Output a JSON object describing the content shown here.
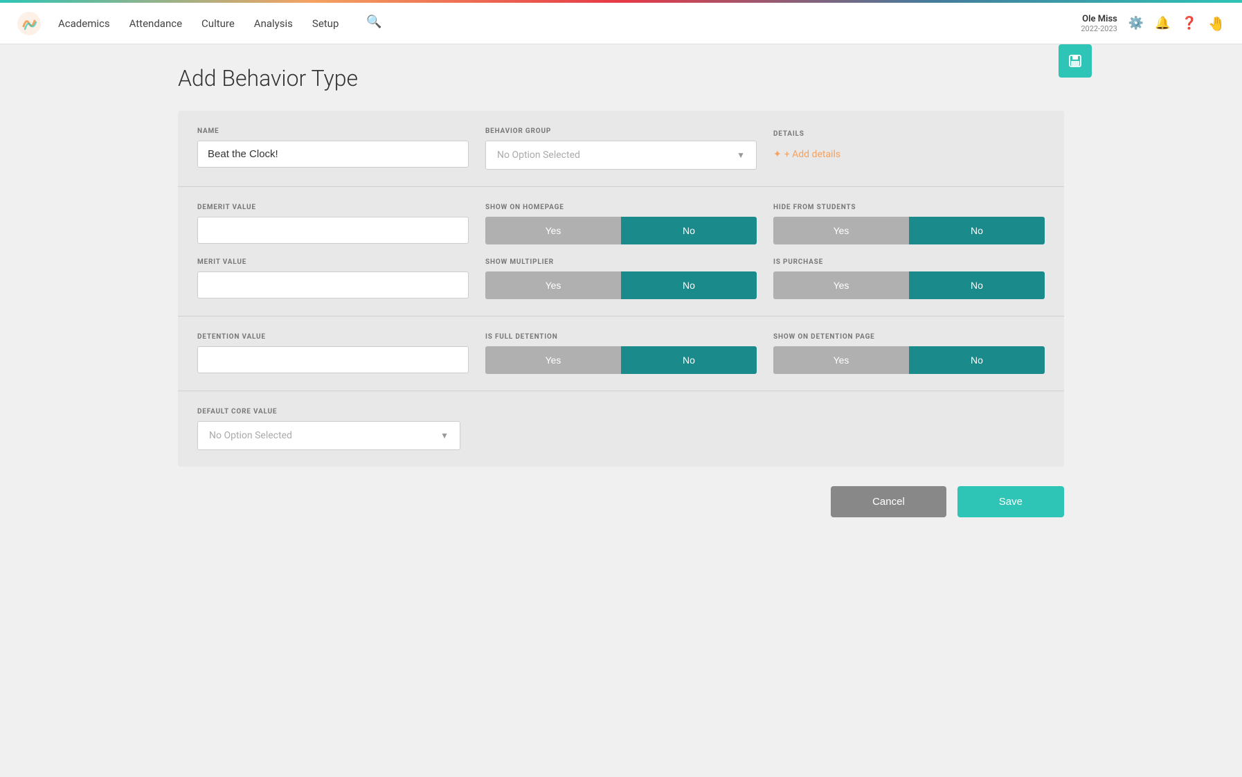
{
  "topAccent": true,
  "nav": {
    "links": [
      "Academics",
      "Attendance",
      "Culture",
      "Analysis",
      "Setup"
    ],
    "user": {
      "name": "Ole Miss",
      "year": "2022-2023"
    },
    "icons": [
      "gear-icon",
      "bell-icon",
      "help-icon",
      "hand-icon"
    ]
  },
  "page": {
    "title": "Add Behavior Type",
    "topSaveIcon": "💾"
  },
  "form": {
    "sections": {
      "top": {
        "name_label": "NAME",
        "name_value": "Beat the Clock!",
        "name_placeholder": "",
        "behavior_group_label": "BEHAVIOR GROUP",
        "behavior_group_placeholder": "No Option Selected",
        "details_label": "DETAILS",
        "add_details_text": "+ Add details"
      },
      "middle": {
        "demerit_label": "DEMERIT VALUE",
        "demerit_value": "",
        "show_homepage_label": "SHOW ON HOMEPAGE",
        "show_homepage_yes": "Yes",
        "show_homepage_no": "No",
        "show_homepage_active": "no",
        "hide_students_label": "HIDE FROM STUDENTS",
        "hide_students_yes": "Yes",
        "hide_students_no": "No",
        "hide_students_active": "no",
        "merit_label": "MERIT VALUE",
        "merit_value": "",
        "show_multiplier_label": "SHOW MULTIPLIER",
        "show_multiplier_yes": "Yes",
        "show_multiplier_no": "No",
        "show_multiplier_active": "no",
        "is_purchase_label": "IS PURCHASE",
        "is_purchase_yes": "Yes",
        "is_purchase_no": "No",
        "is_purchase_active": "no"
      },
      "detention": {
        "detention_value_label": "DETENTION VALUE",
        "detention_value": "",
        "is_full_detention_label": "IS FULL DETENTION",
        "is_full_detention_yes": "Yes",
        "is_full_detention_no": "No",
        "is_full_detention_active": "no",
        "show_detention_page_label": "SHOW ON DETENTION PAGE",
        "show_detention_page_yes": "Yes",
        "show_detention_page_no": "No",
        "show_detention_page_active": "no"
      },
      "core": {
        "default_core_label": "DEFAULT CORE VALUE",
        "default_core_placeholder": "No Option Selected"
      }
    },
    "cancel_label": "Cancel",
    "save_label": "Save"
  }
}
